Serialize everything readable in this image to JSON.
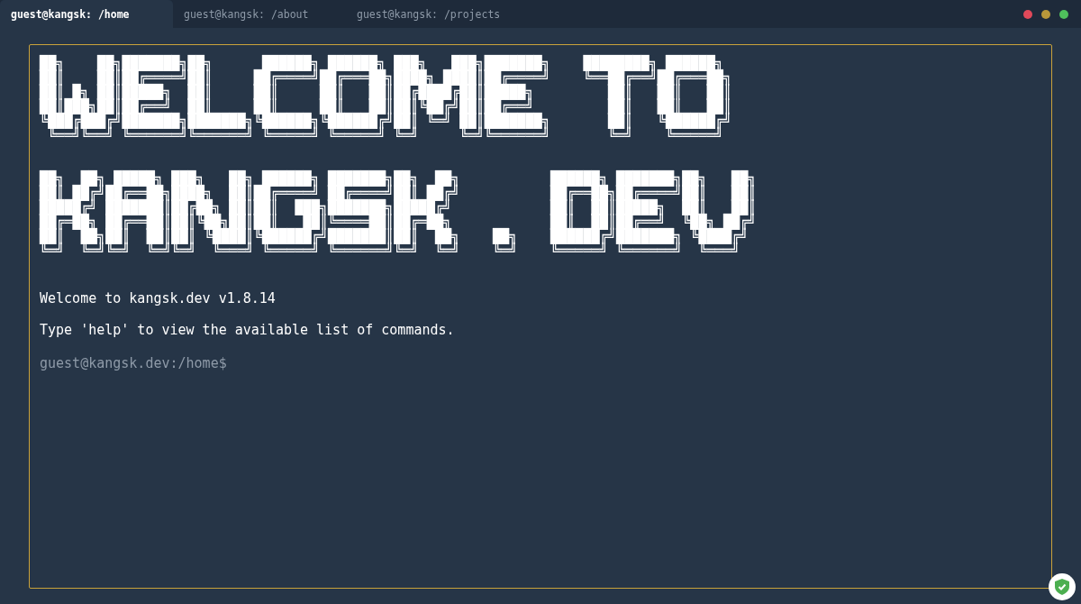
{
  "tabs": [
    {
      "label": "guest@kangsk: /home",
      "selected": true
    },
    {
      "label": "guest@kangsk: /about",
      "selected": false
    },
    {
      "label": "guest@kangsk: /projects",
      "selected": false
    }
  ],
  "window_controls": [
    {
      "color": "#e0495a"
    },
    {
      "color": "#b8973a"
    },
    {
      "color": "#4fbf5c"
    }
  ],
  "terminal": {
    "banner": [
      "██╗    ██╗███████╗██╗      ██████╗ ██████╗ ███╗   ███╗███████╗    ████████╗ ██████╗ ",
      "██║    ██║██╔════╝██║     ██╔════╝██╔═══██╗████╗ ████║██╔════╝    ╚══██╔══╝██╔═══██╗",
      "██║ █╗ ██║█████╗  ██║     ██║     ██║   ██║██╔████╔██║█████╗         ██║   ██║   ██║",
      "██║███╗██║██╔══╝  ██║     ██║     ██║   ██║██║╚██╔╝██║██╔══╝         ██║   ██║   ██║",
      "╚███╔███╔╝███████╗███████╗╚██████╗╚██████╔╝██║ ╚═╝ ██║███████╗       ██║   ╚██████╔╝",
      " ╚══╝╚══╝ ╚══════╝╚══════╝ ╚═════╝ ╚═════╝ ╚═╝     ╚═╝╚══════╝       ╚═╝    ╚═════╝ "
    ],
    "banner_2": [
      "██╗  ██╗ █████╗ ███╗   ██╗ ██████╗ ███████╗██╗  ██╗           ██████╗ ███████╗██╗   ██╗",
      "██║ ██╔╝██╔══██╗████╗  ██║██╔════╝ ██╔════╝██║ ██╔╝           ██╔══██╗██╔════╝██║   ██║",
      "█████╔╝ ███████║██╔██╗ ██║██║  ███╗███████╗█████╔╝            ██║  ██║█████╗  ██║   ██║",
      "██╔═██╗ ██╔══██║██║╚██╗██║██║   ██║╚════██║██╔═██╗            ██║  ██║██╔══╝  ╚██╗ ██╔╝",
      "██║  ██╗██║  ██║██║ ╚████║╚██████╔╝███████║██║  ██╗    ██╗    ██████╔╝███████╗ ╚████╔╝ ",
      "╚═╝  ╚═╝╚═╝  ╚═╝╚═╝  ╚═══╝ ╚═════╝ ╚══════╝╚═╝  ╚═╝    ╚═╝    ╚═════╝ ╚══════╝  ╚═══╝  "
    ],
    "lines": [
      "Welcome to kangsk.dev v1.8.14",
      "Type 'help' to view the available list of commands."
    ],
    "prompt": "guest@kangsk.dev:/home$"
  }
}
